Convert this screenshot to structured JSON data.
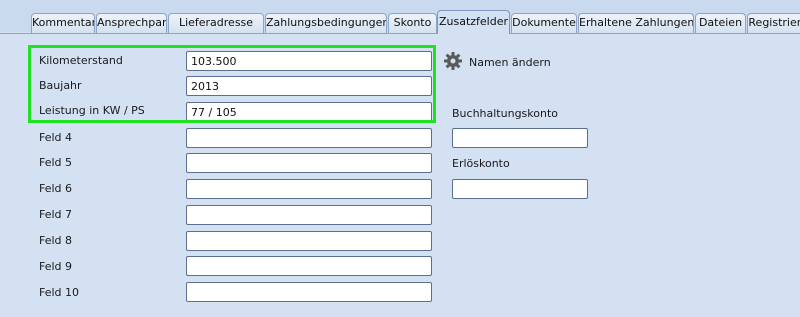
{
  "tabs": [
    {
      "label": "Kommentar",
      "active": false
    },
    {
      "label": "Ansprechpartner",
      "active": false
    },
    {
      "label": "Lieferadresse",
      "active": false
    },
    {
      "label": "Zahlungsbedingungen",
      "active": false
    },
    {
      "label": "Skonto",
      "active": false
    },
    {
      "label": "Zusatzfelder",
      "active": true
    },
    {
      "label": "Dokumente",
      "active": false
    },
    {
      "label": "Erhaltene Zahlungen",
      "active": false
    },
    {
      "label": "Dateien",
      "active": false
    },
    {
      "label": "Registriert",
      "active": false
    }
  ],
  "fields": [
    {
      "label": "Kilometerstand",
      "value": "103.500"
    },
    {
      "label": "Baujahr",
      "value": "2013"
    },
    {
      "label": "Leistung in KW / PS",
      "value": "77 / 105"
    },
    {
      "label": "Feld 4",
      "value": ""
    },
    {
      "label": "Feld 5",
      "value": ""
    },
    {
      "label": "Feld 6",
      "value": ""
    },
    {
      "label": "Feld 7",
      "value": ""
    },
    {
      "label": "Feld 8",
      "value": ""
    },
    {
      "label": "Feld 9",
      "value": ""
    },
    {
      "label": "Feld 10",
      "value": ""
    }
  ],
  "rename_button": {
    "label": "Namen ändern",
    "icon": "gear-icon"
  },
  "accounts": {
    "booking_label": "Buchhaltungskonto",
    "booking_value": "",
    "revenue_label": "Erlöskonto",
    "revenue_value": ""
  },
  "colors": {
    "highlight": "#22e022",
    "background": "#d3e1f3"
  }
}
